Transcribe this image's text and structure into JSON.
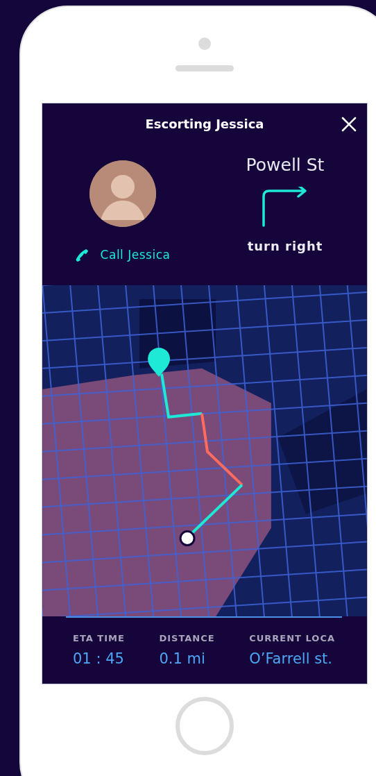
{
  "header": {
    "title": "Escorting Jessica"
  },
  "contact": {
    "call_label": "Call Jessica"
  },
  "direction": {
    "street": "Powell St",
    "instruction": "turn right"
  },
  "stats": [
    {
      "label": "ETA TIME",
      "value": "01 : 45"
    },
    {
      "label": "DISTANCE",
      "value": "0.1 mi"
    },
    {
      "label": "CURRENT LOCA",
      "value": "O’Farrell st."
    }
  ]
}
